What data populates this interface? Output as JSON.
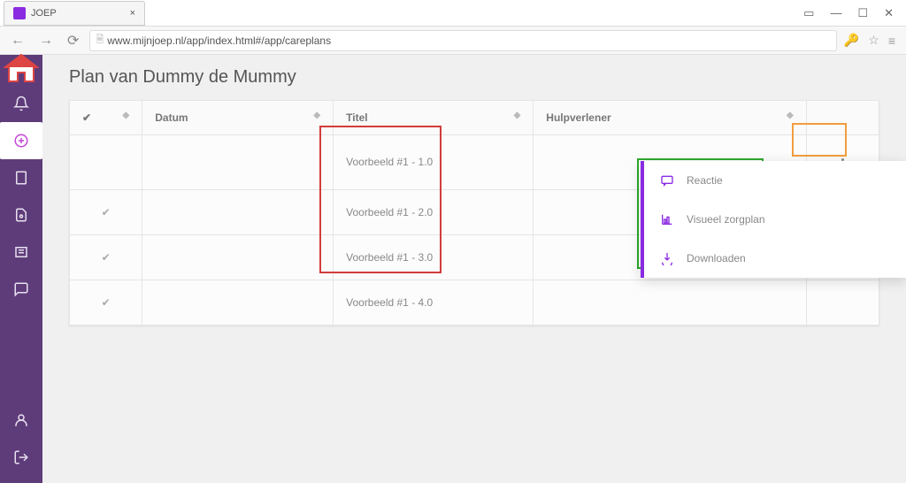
{
  "browser": {
    "tab_title": "JOEP",
    "url": "www.mijnjoep.nl/app/index.html#/app/careplans"
  },
  "page": {
    "title": "Plan van Dummy de Mummy"
  },
  "columns": {
    "datum": "Datum",
    "titel": "Titel",
    "hulpverlener": "Hulpverlener"
  },
  "rows": [
    {
      "checked": false,
      "datum": "",
      "titel": "Voorbeeld #1 - 1.0",
      "hulp": ""
    },
    {
      "checked": true,
      "datum": "",
      "titel": "Voorbeeld #1 - 2.0",
      "hulp": ""
    },
    {
      "checked": true,
      "datum": "",
      "titel": "Voorbeeld #1 - 3.0",
      "hulp": ""
    },
    {
      "checked": true,
      "datum": "",
      "titel": "Voorbeeld #1 - 4.0",
      "hulp": ""
    }
  ],
  "menu": {
    "reactie": "Reactie",
    "visueel": "Visueel zorgplan",
    "downloaden": "Downloaden"
  }
}
